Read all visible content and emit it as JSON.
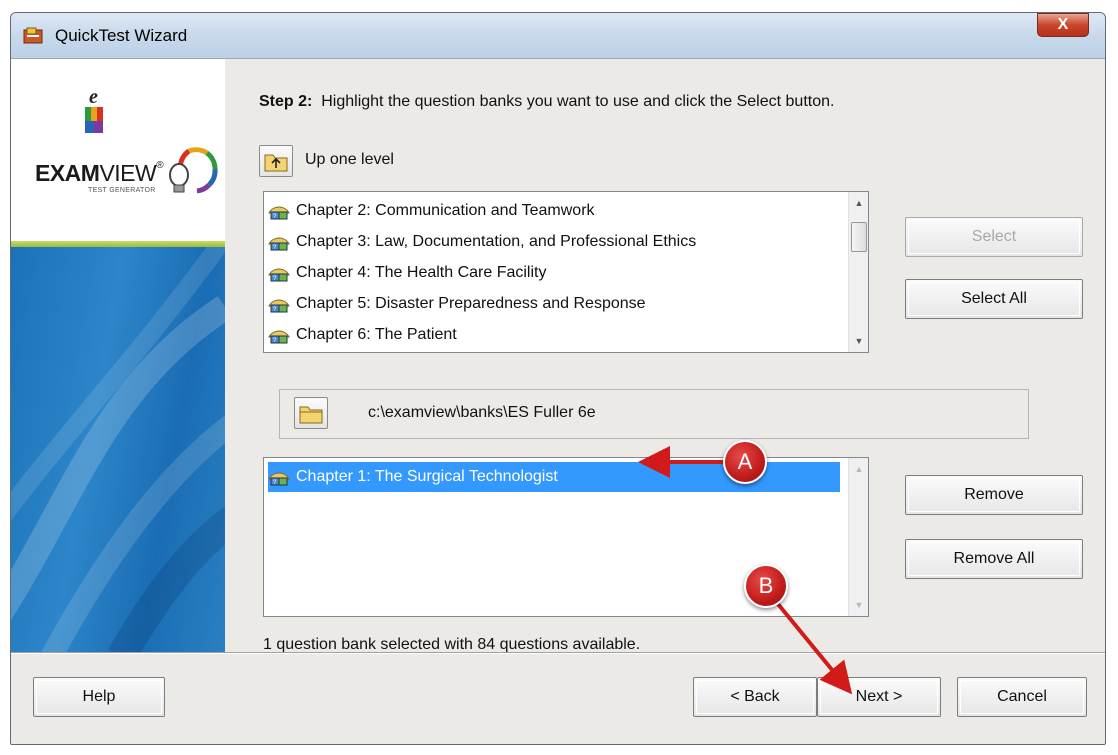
{
  "window": {
    "title": "QuickTest Wizard",
    "close_label": "X"
  },
  "sidebar": {
    "logo_word_bold": "EXAM",
    "logo_word": "VIEW",
    "logo_reg": "®",
    "logo_sub": "TEST GENERATOR"
  },
  "step": {
    "label": "Step 2:",
    "text": "Highlight the question banks you want to use and click the Select button."
  },
  "up_level": {
    "label": "Up one level"
  },
  "available_banks": [
    {
      "label": "Chapter 2: Communication and Teamwork"
    },
    {
      "label": "Chapter 3: Law, Documentation, and Professional Ethics"
    },
    {
      "label": "Chapter 4: The Health Care Facility"
    },
    {
      "label": "Chapter 5: Disaster Preparedness and Response"
    },
    {
      "label": "Chapter 6: The Patient"
    }
  ],
  "buttons": {
    "select": "Select",
    "select_all": "Select All",
    "remove": "Remove",
    "remove_all": "Remove All",
    "help": "Help",
    "back": "< Back",
    "next": "Next >",
    "cancel": "Cancel"
  },
  "folder_path": "c:\\examview\\banks\\ES Fuller 6e",
  "selected_banks": [
    {
      "label": "Chapter 1: The Surgical Technologist",
      "selected": true
    }
  ],
  "status_text": "1 question bank selected with 84 questions available.",
  "annotations": {
    "a": "A",
    "b": "B"
  },
  "colors": {
    "selection": "#3399ff",
    "annotation_red": "#c11b1b",
    "sidebar_blue": "#1b72b8",
    "sidebar_green": "#9bbd3a"
  }
}
